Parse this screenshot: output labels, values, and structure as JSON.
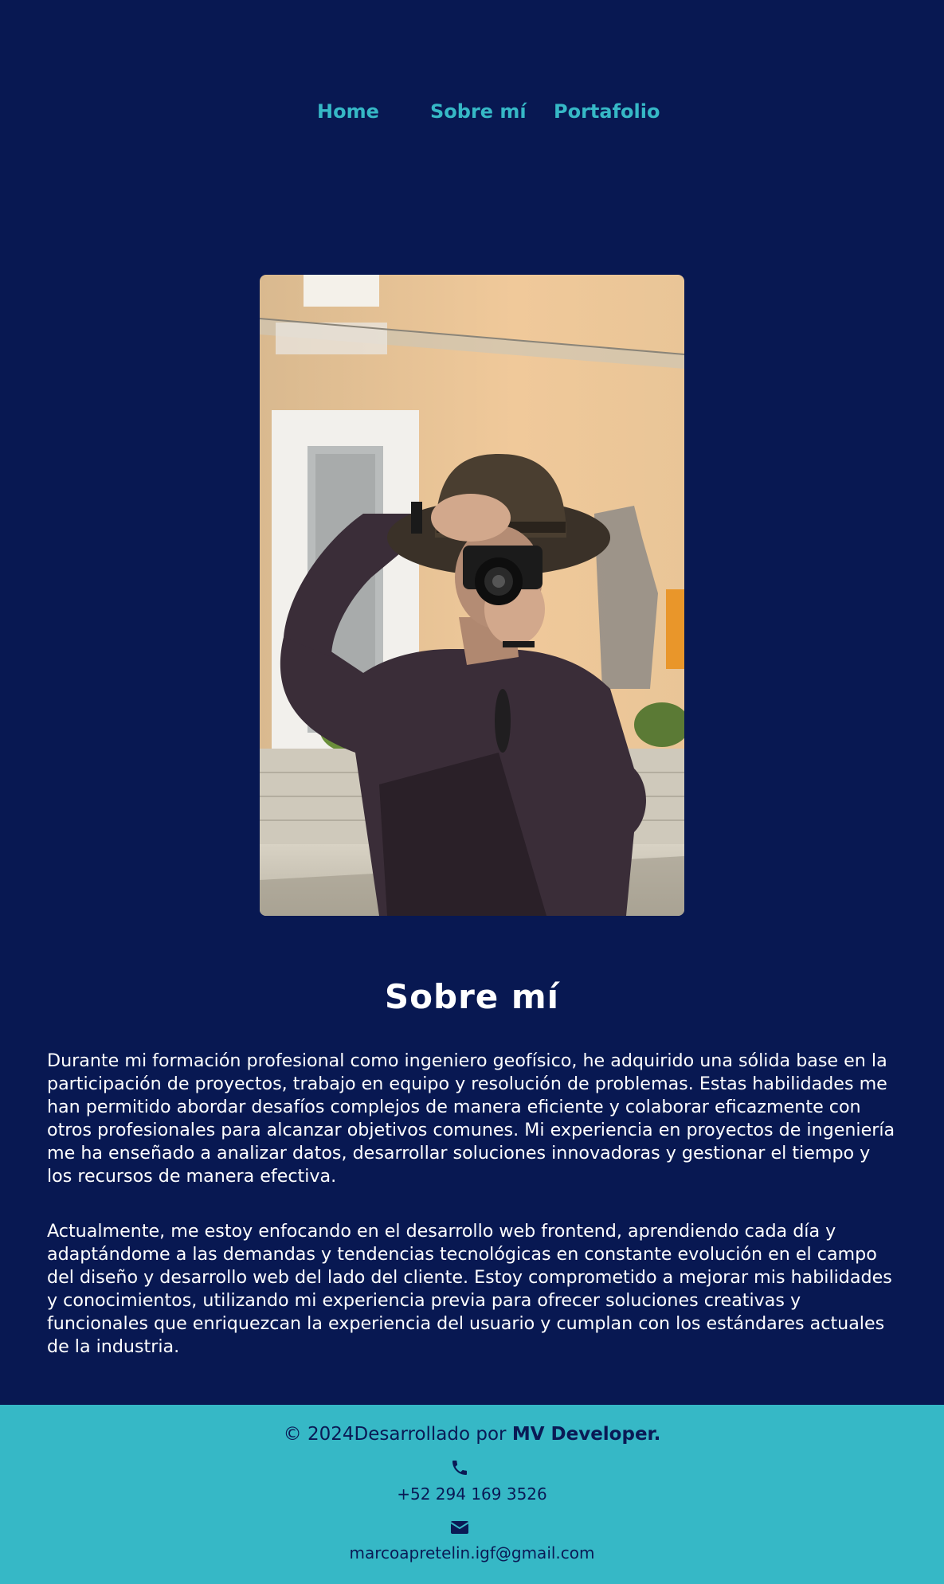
{
  "nav": {
    "items": [
      {
        "label": "Home"
      },
      {
        "label": "Sobre mí"
      },
      {
        "label": "Portafolio"
      }
    ]
  },
  "about": {
    "title": "Sobre mí",
    "paragraphs": [
      "Durante mi formación profesional como ingeniero geofísico, he adquirido una sólida base en la participación de proyectos, trabajo en equipo y resolución de problemas. Estas habilidades me han permitido abordar desafíos complejos de manera eficiente y colaborar eficazmente con otros profesionales para alcanzar objetivos comunes. Mi experiencia en proyectos de ingeniería me ha enseñado a analizar datos, desarrollar soluciones innovadoras y gestionar el tiempo y los recursos de manera efectiva.",
      "Actualmente, me estoy enfocando en el desarrollo web frontend, aprendiendo cada día y adaptándome a las demandas y tendencias tecnológicas en constante evolución en el campo del diseño y desarrollo web del lado del cliente. Estoy comprometido a mejorar mis habilidades y conocimientos, utilizando mi experiencia previa para ofrecer soluciones creativas y funcionales que enriquezcan la experiencia del usuario y cumplan con los estándares actuales de la industria."
    ]
  },
  "footer": {
    "copyright": "© 2024Desarrollado por ",
    "brand": "MV Developer.",
    "phone": "+52 294 169 3526",
    "email": "marcoapretelin.igf@gmail.com"
  },
  "colors": {
    "background": "#081852",
    "accent": "#36b8c6",
    "text": "#ffffff",
    "footer_text": "#0a1a55"
  },
  "icons": [
    "phone-icon",
    "envelope-icon"
  ]
}
